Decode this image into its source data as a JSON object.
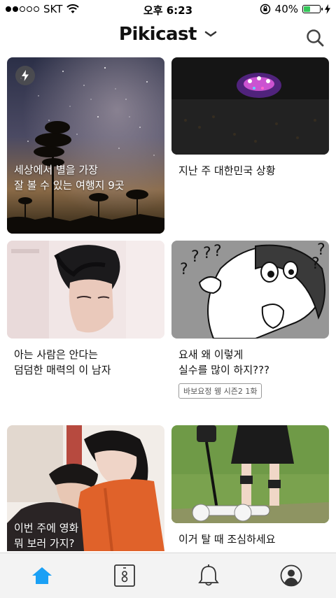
{
  "status_bar": {
    "carrier": "SKT",
    "time": "오후 6:23",
    "battery_percent": "40%",
    "battery_level": 0.4
  },
  "header": {
    "logo": "Pikicast",
    "icons": [
      "chevron-down-icon",
      "search-icon"
    ]
  },
  "cards": [
    {
      "title": "세상에서 별을 가장\n잘 볼 수 있는 여행지 9곳",
      "badge": "lightning-icon"
    },
    {
      "title": "지난 주 대한민국 상황"
    },
    {
      "title": "아는 사람은 안다는\n덤덤한 매력의 이 남자"
    },
    {
      "title": "요새 왜 이렇게\n실수를 많이 하지???",
      "tag": "바보요정 웽 시즌2 1화"
    },
    {
      "title": "이번 주에 영화\n뭐 보러 가지?"
    },
    {
      "title": "이거 탈 때 조심하세요"
    }
  ],
  "tabbar": {
    "items": [
      "home-icon",
      "cards-icon",
      "notification-bell-icon",
      "profile-icon"
    ],
    "active_color": "#1aa0f5"
  }
}
